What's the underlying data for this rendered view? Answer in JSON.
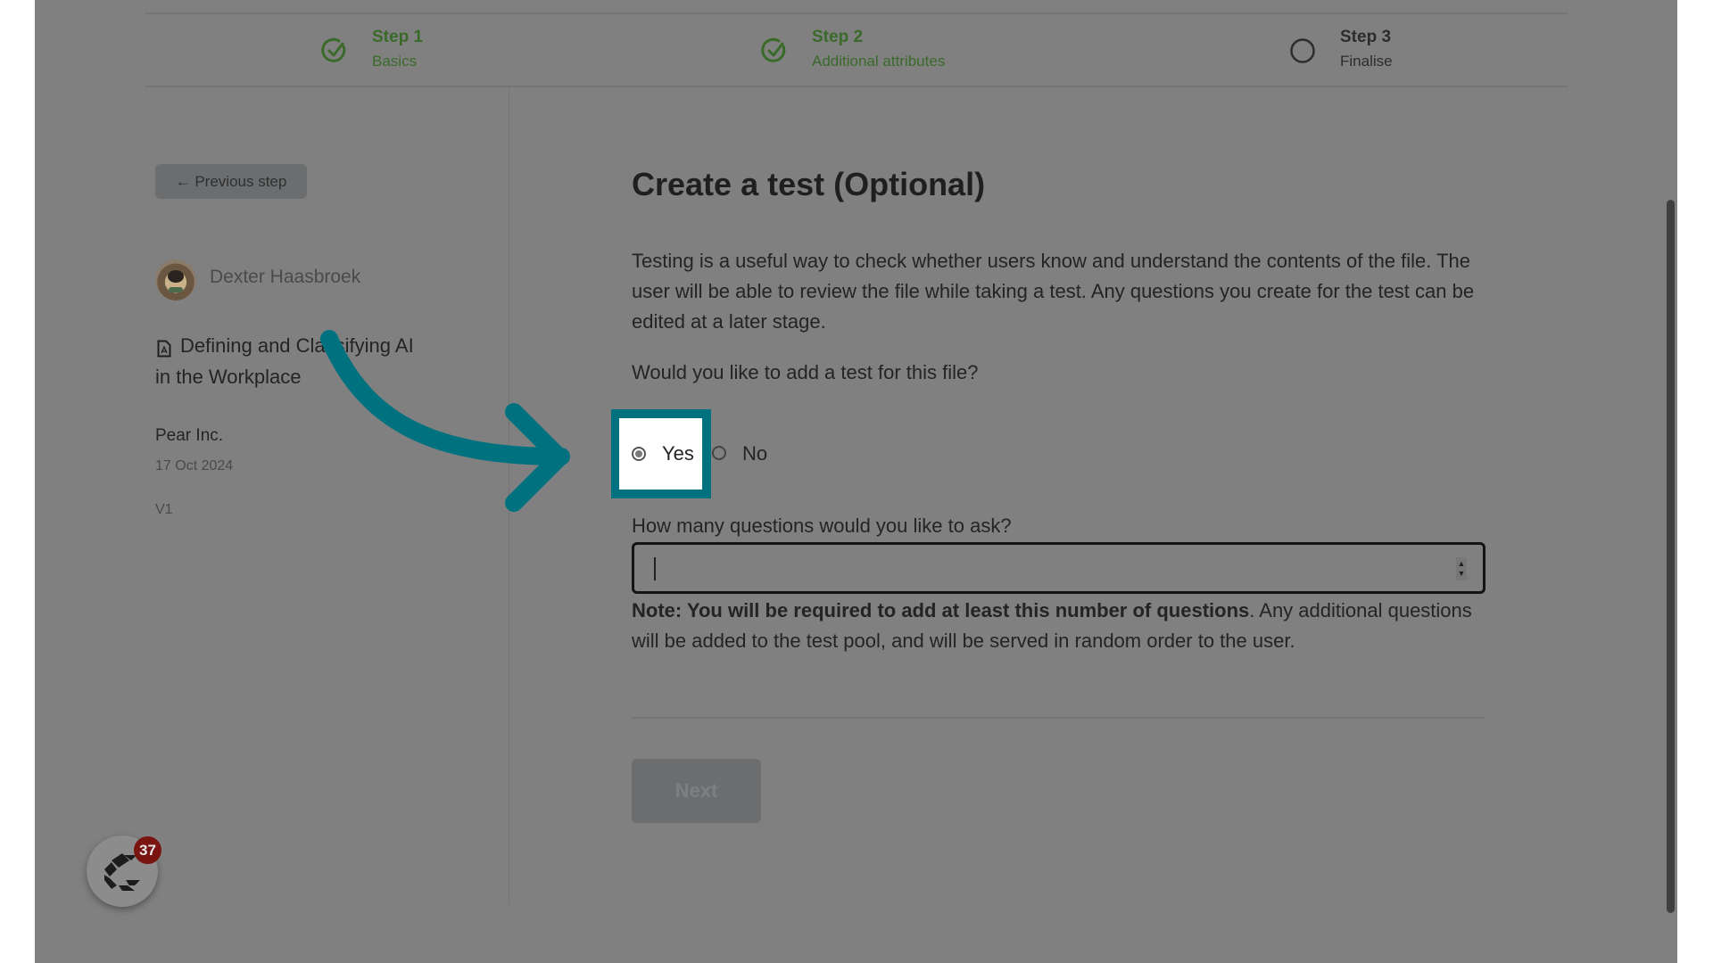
{
  "stepper": {
    "steps": [
      {
        "title": "Step 1",
        "subtitle": "Basics",
        "status": "complete"
      },
      {
        "title": "Step 2",
        "subtitle": "Additional attributes",
        "status": "complete"
      },
      {
        "title": "Step 3",
        "subtitle": "Finalise",
        "status": "pending"
      }
    ]
  },
  "sidebar": {
    "previous_step_label": "← Previous step",
    "author_name": "Dexter Haasbroek",
    "document_title_line1": "Defining and Classifying AI",
    "document_title_line2": "in the Workplace",
    "organization": "Pear Inc.",
    "date": "17 Oct 2024",
    "version": "V1"
  },
  "main": {
    "heading": "Create a test (Optional)",
    "description": "Testing is a useful way to check whether users know and understand the contents of the file. The user will be able to review the file while taking a test. Any questions you create for the test can be edited at a later stage.",
    "question": "Would you like to add a test for this file?",
    "options": [
      {
        "label": "Yes",
        "selected": true
      },
      {
        "label": "No",
        "selected": false
      }
    ],
    "count_label": "How many questions would you like to ask?",
    "count_value": "",
    "note_bold": "Note: You will be required to add at least this number of questions",
    "note_rest": ". Any additional questions will be added to the test pool, and will be served in random order to the user.",
    "next_label": "Next"
  },
  "widget": {
    "badge_count": "37"
  },
  "colors": {
    "overlay": "#808080",
    "highlight": "#00727f",
    "step_complete": "#3a6a2a",
    "badge": "#7a1410"
  }
}
